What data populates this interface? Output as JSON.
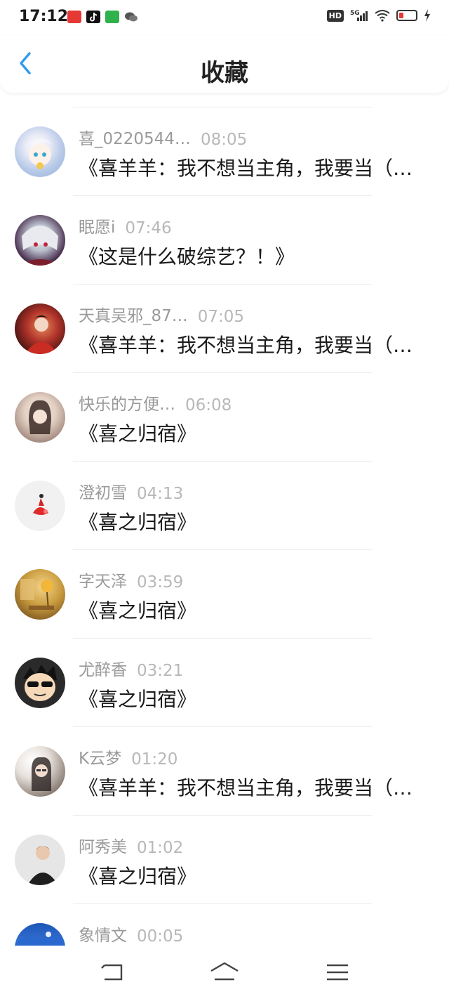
{
  "status_bar": {
    "time": "17:12",
    "app_icons": [
      "toutiao-icon",
      "tiktok-icon",
      "iqiyi-icon",
      "wechat-icon"
    ],
    "network": "5G",
    "hd_label": "HD"
  },
  "header": {
    "title": "收藏",
    "accent_color": "#2d9cf0"
  },
  "items": [
    {
      "user": "喜_0220544…",
      "time": "08:05",
      "title": "《喜羊羊：我不想当主角，我要当（…",
      "avatar": "anime-girl-white-hair"
    },
    {
      "user": "眠愿i",
      "time": "07:46",
      "title": "《这是什么破综艺？！》",
      "avatar": "anime-boy-white-hair"
    },
    {
      "user": "天真吴邪_87…",
      "time": "07:05",
      "title": "《喜羊羊：我不想当主角，我要当（…",
      "avatar": "red-ancient-figure"
    },
    {
      "user": "快乐的方便…",
      "time": "06:08",
      "title": "《喜之归宿》",
      "avatar": "girl-photo"
    },
    {
      "user": "澄初雪",
      "time": "04:13",
      "title": "《喜之归宿》",
      "avatar": "red-dress-figure"
    },
    {
      "user": "字天泽",
      "time": "03:59",
      "title": "《喜之归宿》",
      "avatar": "golden-room"
    },
    {
      "user": "尤醉香",
      "time": "03:21",
      "title": "《喜之归宿》",
      "avatar": "cartoon-sunglasses"
    },
    {
      "user": "K云梦",
      "time": "01:20",
      "title": "《喜羊羊：我不想当主角，我要当（…",
      "avatar": "girl-with-glasses"
    },
    {
      "user": "阿秀美",
      "time": "01:02",
      "title": "《喜之归宿》",
      "avatar": "man-dark-shirt"
    },
    {
      "user": "象情文",
      "time": "00:05",
      "title": "",
      "avatar": "blue-sky"
    }
  ],
  "nav_bar": {
    "buttons": [
      "back-nav-icon",
      "home-nav-icon",
      "menu-nav-icon"
    ]
  }
}
